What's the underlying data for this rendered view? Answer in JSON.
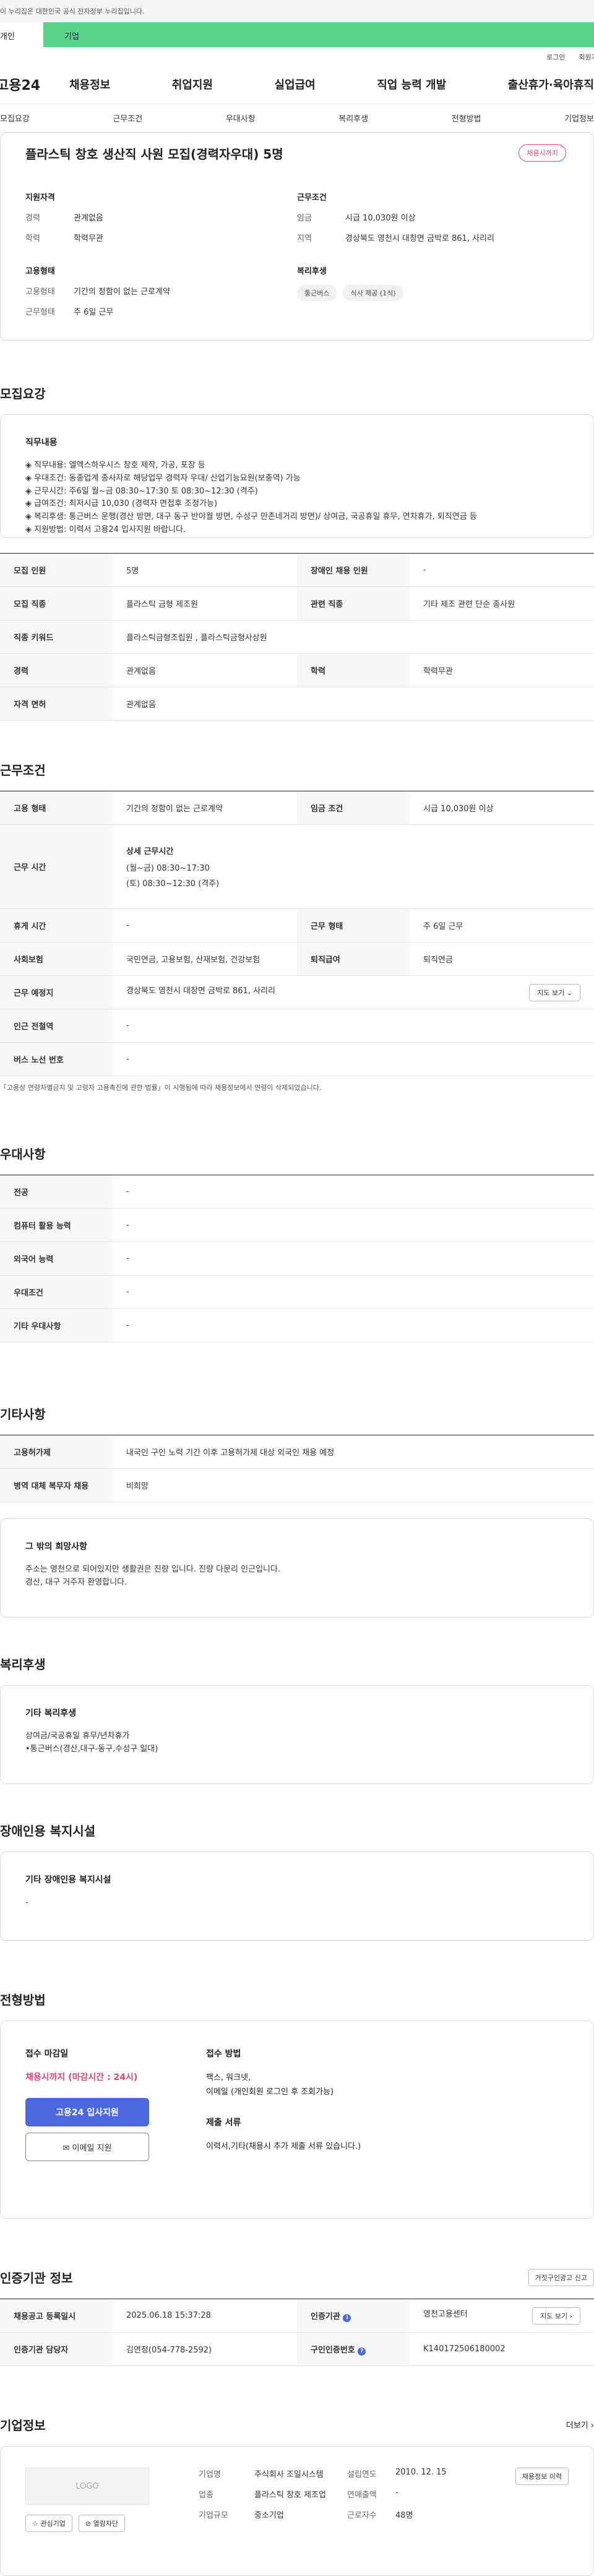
{
  "gov_bar": "이 누리집은 대한민국 공식 전자정부 누리집입니다.",
  "tabs": {
    "person": "개인",
    "biz": "기업"
  },
  "util": {
    "login": "로그인",
    "join": "회원가입"
  },
  "gnb": {
    "logo": "고용24",
    "menu": [
      "채용정보",
      "취업지원",
      "실업급여",
      "직업 능력 개발",
      "출산휴가·육아휴직"
    ]
  },
  "anchor_nav": [
    "모집요강",
    "근무조건",
    "우대사항",
    "복리후생",
    "전형방법",
    "기업정보"
  ],
  "summary": {
    "title": "플라스틱 창호 생산직 사원 모집(경력자우대) 5명",
    "badge": "채용시까지",
    "qual_h": "지원자격",
    "career_k": "경력",
    "career_v": "관계없음",
    "edu_k": "학력",
    "edu_v": "학력무관",
    "cond_h": "근무조건",
    "wage_k": "임금",
    "wage_v": "시급 10,030원 이상",
    "region_k": "지역",
    "region_v": "경상북도 영천시 대창면 금박로 861, 사리리",
    "emp_h": "고용형태",
    "emptype_k": "고용형태",
    "emptype_v": "기간의 정함이 없는 근로계약",
    "workform_k": "근무형태",
    "workform_v": "주 6일 근무",
    "welfare_h": "복리후생",
    "chips": [
      "통근버스",
      "식사 제공 (1식)"
    ]
  },
  "recruit": {
    "title": "모집요강",
    "job_h": "직무내용",
    "lines": [
      "◈ 직무내용: 엘엑스하우시스 창호 제작, 가공, 포장 등",
      "◈ 우대조건: 동종업계 종사자로 해당업무 경력자 우대/ 산업기능요원(보충역) 가능",
      "◈ 근무시간: 주6일 월~금 08:30~17:30 토 08:30~12:30 (격주)",
      "◈ 급여조건: 최저시급 10,030 (경력자 면접후 조정가능)",
      "◈ 복리후생: 통근버스 운행(경산 방면, 대구 동구 반야월 방면, 수성구 만촌네거리 방면)/ 상여금, 국공휴일 휴무, 연차휴가, 퇴직연금 등",
      "◈ 지원방법: 이력서 고용24 입사지원 바랍니다."
    ],
    "table": {
      "count_k": "모집 인원",
      "count_v": "5명",
      "disabled_k": "장애인 채용 인원",
      "disabled_v": "-",
      "job_k": "모집 직종",
      "job_v": "플라스틱 금형 제조원",
      "related_k": "관련 직종",
      "related_v": "기타 제조 관련 단순 종사원",
      "keyword_k": "직종 키워드",
      "keyword_v": "플라스틱금형조립원 , 플라스틱금형사상원",
      "career_k": "경력",
      "career_v": "관계없음",
      "edu_k": "학력",
      "edu_v": "학력무관",
      "license_k": "자격 면허",
      "license_v": "관계없음"
    }
  },
  "work": {
    "title": "근무조건",
    "emptype_k": "고용 형태",
    "emptype_v": "기간의 정함이 없는 근로계약",
    "wage_k": "임금 조건",
    "wage_v": "시급 10,030원 이상",
    "hours_k": "근무 시간",
    "hours_detail_h": "상세 근무시간",
    "hours_line1": "(월~금) 08:30~17:30",
    "hours_line2": "(토) 08:30~12:30 (격주)",
    "break_k": "휴게 시간",
    "break_v": "-",
    "form_k": "근무 형태",
    "form_v": "주 6일 근무",
    "ins_k": "사회보험",
    "ins_v": "국민연금, 고용보험, 산재보험, 건강보험",
    "retire_k": "퇴직급여",
    "retire_v": "퇴직연금",
    "place_k": "근무 예정지",
    "place_v": "경상북도 영천시 대창면 금박로 861, 사리리",
    "map_btn": "지도 보기 ⌄",
    "subway_k": "인근 전철역",
    "subway_v": "-",
    "bus_k": "버스 노선 번호",
    "bus_v": "-",
    "note": "「고용상 연령차별금지 및 고령자 고용촉진에 관한 법률」이 시행됨에 따라 채용정보에서 연령이 삭제되었습니다."
  },
  "pref": {
    "title": "우대사항",
    "major_k": "전공",
    "major_v": "-",
    "pc_k": "컴퓨터 활용 능력",
    "pc_v": "-",
    "lang_k": "외국어 능력",
    "lang_v": "-",
    "cond_k": "우대조건",
    "cond_v": "-",
    "etc_k": "기타 우대사항",
    "etc_v": "-"
  },
  "etc": {
    "title": "기타사항",
    "permit_k": "고용허가제",
    "permit_v": "내국인 구인 노력 기간 이후 고용허가제 대상 외국인 채용 예정",
    "military_k": "병역 대체 복무자 채용",
    "military_v": "비희망",
    "wish_h": "그 밖의 희망사항",
    "wish_line1": "주소는 영천으로 되어있지만 생활권은 진량 입니다. 진량 다문리 인근입니다.",
    "wish_line2": "경산, 대구 거주자 환영합니다."
  },
  "welfare": {
    "title": "복리후생",
    "h": "기타 복리후생",
    "line1": "상여금/국공휴일 휴무/년차휴가",
    "line2": "•통근버스(경산,대구-동구,수성구 일대)"
  },
  "disabled": {
    "title": "장애인용 복지시설",
    "h": "기타 장애인용 복지시설",
    "v": "-"
  },
  "method": {
    "title": "전형방법",
    "deadline_h": "접수 마감일",
    "deadline": "채용시까지 (마감시간 : 24시)",
    "apply_btn": "고용24 입사지원",
    "email_btn": "✉ 이메일 지원",
    "way_h": "접수 방법",
    "way_line1": "팩스, 워크넷,",
    "way_line2": "이메일 (개인회원 로그인 후 조회가능)",
    "docs_h": "제출 서류",
    "docs_v": "이력서,기타(채용시 추가 제출 서류 있습니다.)"
  },
  "agency": {
    "title": "인증기관 정보",
    "report_btn": "거짓구인광고 신고",
    "reg_k": "채용공고 등록일시",
    "reg_v": "2025.06.18 15:37:28",
    "org_k": "인증기관",
    "org_v": "영천고용센터",
    "map_btn": "지도 보기 ›",
    "staff_k": "인증기관 담당자",
    "staff_v": "김연정(054-778-2592)",
    "no_k": "구인인증번호",
    "no_v": "K140172506180002"
  },
  "company": {
    "title": "기업정보",
    "more": "더보기 ›",
    "logo": "LOGO",
    "fav_btn": "☆ 관심기업",
    "block_btn": "⊘ 열람차단",
    "name_k": "기업명",
    "name_v": "주식회사 조일시스템",
    "biz_k": "업종",
    "biz_v": "플라스틱 창호 제조업",
    "size_k": "기업규모",
    "size_v": "중소기업",
    "year_k": "설립연도",
    "year_v": "2010. 12. 15",
    "sales_k": "연매출액",
    "sales_v": "-",
    "emp_k": "근로자수",
    "emp_v": "48명",
    "history_btn": "채용정보 이력"
  }
}
